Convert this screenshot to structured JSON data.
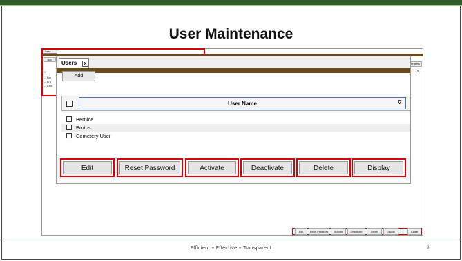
{
  "slide": {
    "title": "User Maintenance",
    "footer": "Efficient   •   Effective   •   Transparent",
    "page_number": "9"
  },
  "background_screenshot": {
    "tab_label": "Users",
    "add_label": "Add",
    "export_label": "Excel Filters",
    "rows": [
      "Ber",
      "Bru",
      "Cem"
    ],
    "toolbar": [
      "Edit",
      "Reset Password",
      "Activate",
      "Deactivate",
      "Delete",
      "Display"
    ],
    "close_label": "Close"
  },
  "window": {
    "tab_label": "Users",
    "tab_close": "x",
    "add_label": "Add",
    "column_header": "User Name",
    "filter_icon": "funnel-icon",
    "rows": [
      {
        "name": "Bernice",
        "mark": "A"
      },
      {
        "name": "Brutus",
        "mark": "A"
      },
      {
        "name": "Cemetery User",
        "mark": "A"
      }
    ]
  },
  "actions": {
    "edit": "Edit",
    "reset_password": "Reset Password",
    "activate": "Activate",
    "deactivate": "Deactivate",
    "delete": "Delete",
    "display": "Display"
  },
  "colors": {
    "accent_green": "#2f5a2b",
    "header_brown": "#6b4a1b",
    "highlight_red": "#dd0000"
  }
}
